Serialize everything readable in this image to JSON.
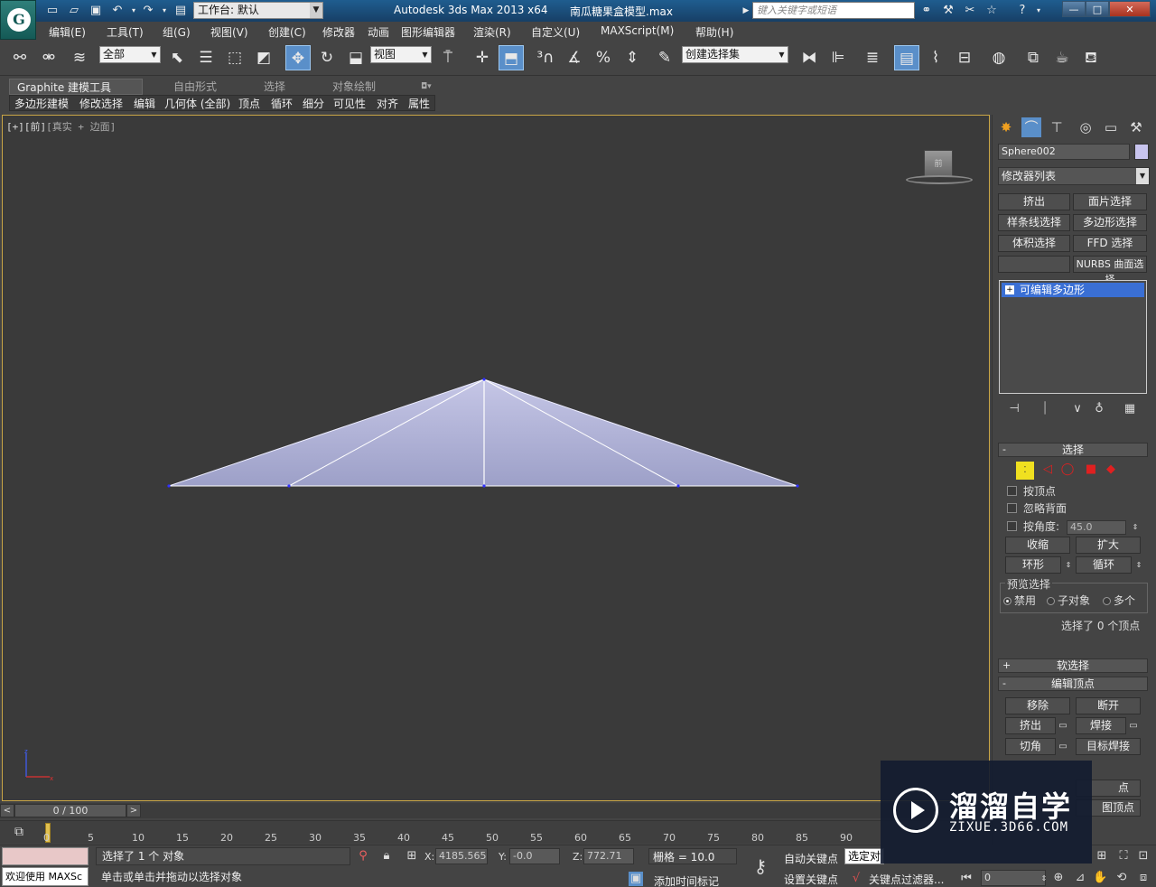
{
  "titlebar": {
    "workspace": "工作台: 默认",
    "app_title": "Autodesk 3ds Max  2013 x64",
    "file_title": "南瓜糖果盒模型.max",
    "search_placeholder": "键入关键字或短语",
    "minimize": "—",
    "maximize": "□",
    "close": "✕"
  },
  "menu": [
    "编辑(E)",
    "工具(T)",
    "组(G)",
    "视图(V)",
    "创建(C)",
    "修改器",
    "动画",
    "图形编辑器",
    "渲染(R)",
    "自定义(U)",
    "MAXScript(M)",
    "帮助(H)"
  ],
  "toolbar": {
    "selection_filter": "全部",
    "reference_coord": "视图",
    "named_selection_set": "创建选择集"
  },
  "ribbon": {
    "tabs": [
      "Graphite 建模工具",
      "自由形式",
      "选择",
      "对象绘制"
    ],
    "panels": [
      "多边形建模",
      "修改选择",
      "编辑",
      "几何体 (全部)",
      "顶点",
      "循环",
      "细分",
      "可见性",
      "对齐",
      "属性"
    ]
  },
  "viewport": {
    "label_plus": "[+]",
    "label_view": "[前]",
    "label_shading": "[真实 + 边面]",
    "viewcube_face": "前"
  },
  "command_panel": {
    "object_name": "Sphere002",
    "object_color": "#c8c4ee",
    "modifier_list": "修改器列表",
    "modifier_buttons": [
      "挤出",
      "面片选择",
      "样条线选择",
      "多边形选择",
      "体积选择",
      "FFD 选择",
      "",
      "NURBS 曲面选择"
    ],
    "stack_item": "可编辑多边形",
    "selection_rollout": {
      "title": "选择",
      "by_vertex": "按顶点",
      "ignore_backfacing": "忽略背面",
      "by_angle": "按角度:",
      "angle_value": "45.0",
      "shrink": "收缩",
      "grow": "扩大",
      "ring": "环形",
      "loop": "循环",
      "preview_title": "预览选择",
      "preview_off": "禁用",
      "preview_subobj": "子对象",
      "preview_multi": "多个",
      "status": "选择了 0 个顶点"
    },
    "soft_selection": "软选择",
    "edit_vertices": {
      "title": "编辑顶点",
      "remove": "移除",
      "break": "断开",
      "extrude": "挤出",
      "weld": "焊接",
      "chamfer": "切角",
      "target_weld": "目标焊接",
      "partial_a": "点",
      "partial_b": "图顶点"
    }
  },
  "timeline": {
    "slider": "0 / 100",
    "ticks": [
      "0",
      "5",
      "10",
      "15",
      "20",
      "25",
      "30",
      "35",
      "40",
      "45",
      "50",
      "55",
      "60",
      "65",
      "70",
      "75",
      "80",
      "85",
      "90"
    ]
  },
  "status": {
    "welcome": "欢迎使用 MAXSc",
    "line1": "选择了 1 个 对象",
    "line2": "单击或单击并拖动以选择对象",
    "x": "4185.565",
    "y": "-0.0",
    "z": "772.71",
    "grid": "栅格 = 10.0",
    "auto_key": "自动关键点",
    "set_key": "设置关键点",
    "selected_set": "选定对",
    "key_filters": "关键点过滤器...",
    "add_time_tag": "添加时间标记",
    "frame": "0"
  },
  "watermark": {
    "name": "溜溜自学",
    "url": "ZIXUE.3D66.COM"
  }
}
